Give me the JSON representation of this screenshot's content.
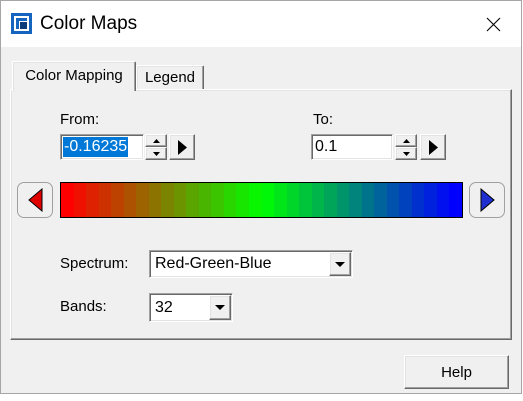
{
  "window": {
    "title": "Color Maps",
    "app_icon": "color-maps-app-icon",
    "close_icon": "close-icon"
  },
  "tabs": [
    {
      "label": "Color Mapping",
      "selected": true
    },
    {
      "label": "Legend",
      "selected": false
    }
  ],
  "range": {
    "from": {
      "label": "From:",
      "value": "-0.16235",
      "text_selected": true
    },
    "to": {
      "label": "To:",
      "value": "0.1",
      "text_selected": false
    }
  },
  "color_bar": {
    "spectrum_colors": [
      "#ff0000",
      "#00ff00",
      "#0000ff"
    ],
    "left_button_icon": "triangle-left-icon",
    "left_button_color": "#e00000",
    "right_button_icon": "triangle-right-icon",
    "right_button_color": "#1f2fcf"
  },
  "spectrum": {
    "label": "Spectrum:",
    "value": "Red-Green-Blue"
  },
  "bands": {
    "label": "Bands:",
    "value": "32"
  },
  "help_button": {
    "label": "Help"
  },
  "colors": {
    "dialog_background": "#f0f0f0",
    "titlebar_background": "#ffffff",
    "selection_highlight": "#0078d7"
  }
}
